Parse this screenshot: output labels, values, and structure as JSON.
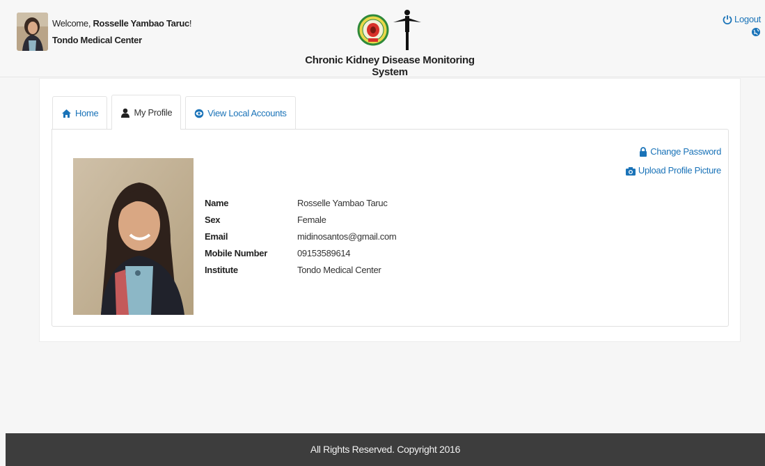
{
  "header": {
    "welcome_prefix": "Welcome, ",
    "user_name": "Rosselle Yambao Taruc",
    "welcome_suffix": "!",
    "institute": "Tondo Medical Center",
    "system_title": "Chronic Kidney Disease Monitoring System",
    "logout_label": "Logout",
    "colors": {
      "link": "#1a73b8",
      "footer_bg": "#3d3d3d"
    }
  },
  "tabs": [
    {
      "label": "Home",
      "icon": "home-icon"
    },
    {
      "label": "My Profile",
      "icon": "user-icon"
    },
    {
      "label": "View Local Accounts",
      "icon": "eye-icon"
    }
  ],
  "actions": {
    "change_password": "Change Password",
    "upload_picture": "Upload Profile Picture"
  },
  "profile": {
    "fields": [
      {
        "label": "Name",
        "value": "Rosselle Yambao Taruc"
      },
      {
        "label": "Sex",
        "value": "Female"
      },
      {
        "label": "Email",
        "value": "midinosantos@gmail.com"
      },
      {
        "label": "Mobile Number",
        "value": "09153589614"
      },
      {
        "label": "Institute",
        "value": "Tondo Medical Center"
      }
    ]
  },
  "footer": {
    "text": "All Rights Reserved. Copyright 2016"
  }
}
